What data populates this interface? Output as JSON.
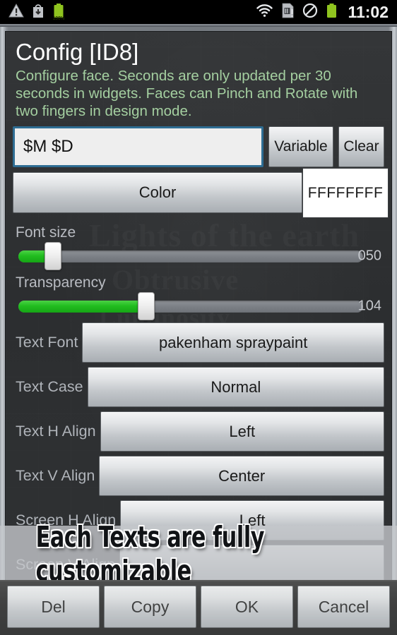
{
  "statusbar": {
    "left_icons": [
      {
        "name": "warning-icon",
        "glyph": "warning"
      },
      {
        "name": "download-bag-icon",
        "glyph": "download"
      },
      {
        "name": "battery-icon",
        "glyph": "battery",
        "label": "100%"
      }
    ],
    "right_icons": [
      {
        "name": "wifi-icon",
        "glyph": "wifi"
      },
      {
        "name": "sim-card-alert-icon",
        "glyph": "sim"
      },
      {
        "name": "do-not-disturb-icon",
        "glyph": "block"
      },
      {
        "name": "battery-icon",
        "glyph": "battery"
      }
    ],
    "battery_percent": "100%",
    "clock": "11:02"
  },
  "dialog": {
    "title": "Config [ID8]",
    "description": "Configure face. Seconds are only updated per 30 seconds in widgets. Faces can Pinch and Rotate with two fingers in design mode.",
    "input": {
      "value": "$M $D",
      "placeholder": "$M $D"
    },
    "buttons": {
      "variable": "Variable",
      "clear": "Clear",
      "color": "Color"
    },
    "color_swatch": {
      "hex_label": "FFFFFFFF",
      "hex": "#FFFFFF"
    },
    "sliders": [
      {
        "label": "Font size",
        "value": "050",
        "fill_percent": 10,
        "thumb_percent": 10
      },
      {
        "label": "Transparency",
        "value": "104",
        "fill_percent": 37,
        "thumb_percent": 37
      }
    ],
    "options": [
      {
        "label": "Text Font",
        "value": "pakenham spraypaint"
      },
      {
        "label": "Text Case",
        "value": "Normal"
      },
      {
        "label": "Text H Align",
        "value": "Left"
      },
      {
        "label": "Text V Align",
        "value": "Center"
      },
      {
        "label": "Screen H Align",
        "value": "Left"
      },
      {
        "label": "Screen V Align",
        "value": ""
      }
    ],
    "footer": {
      "del": "Del",
      "copy": "Copy",
      "ok": "OK",
      "cancel": "Cancel"
    }
  },
  "overlay": {
    "toast_text": "Each Texts are fully customizable"
  },
  "ghost_words": {
    "w1": "Lights of the earth",
    "w2": "Obtrusive",
    "w3": "Luminosity"
  },
  "colors": {
    "accent_green": "#21bd1f",
    "subtitle_green": "#a4cfa0",
    "input_border_blue": "#2e6d93",
    "dialog_bg": "#2f3133",
    "frame_gray": "#9aa0a6"
  }
}
